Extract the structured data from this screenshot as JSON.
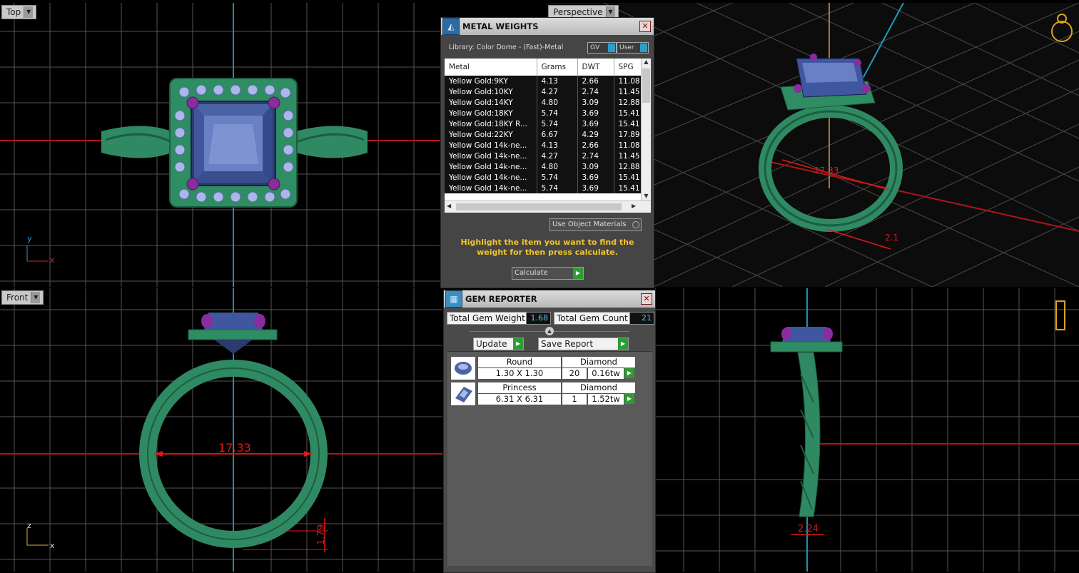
{
  "viewports": {
    "top": {
      "label": "Top"
    },
    "perspective": {
      "label": "Perspective"
    },
    "front": {
      "label": "Front"
    },
    "right": {
      "label": ""
    }
  },
  "axes": {
    "top_y": "y",
    "top_x": "x",
    "front_z": "z",
    "front_x": "x"
  },
  "dimensions": {
    "front_inner_diameter": "17.33",
    "front_band_height": "1.79",
    "right_band_width": "2.24",
    "persp_diameter": "17.33",
    "persp_small": "2.1"
  },
  "metal_weights": {
    "title": "METAL WEIGHTS",
    "library": "Library: Color Dome - (Fast)-Metal",
    "gv_label": "GV",
    "user_label": "User",
    "columns": [
      "Metal",
      "Grams",
      "DWT",
      "SPG"
    ],
    "rows": [
      [
        "Yellow Gold:9KY",
        "4.13",
        "2.66",
        "11.08"
      ],
      [
        "Yellow Gold:10KY",
        "4.27",
        "2.74",
        "11.45"
      ],
      [
        "Yellow Gold:14KY",
        "4.80",
        "3.09",
        "12.88"
      ],
      [
        "Yellow Gold:18KY",
        "5.74",
        "3.69",
        "15.41"
      ],
      [
        "Yellow Gold:18KY R...",
        "5.74",
        "3.69",
        "15.41"
      ],
      [
        "Yellow Gold:22KY",
        "6.67",
        "4.29",
        "17.89"
      ],
      [
        "Yellow Gold 14k-ne...",
        "4.13",
        "2.66",
        "11.08"
      ],
      [
        "Yellow Gold 14k-ne...",
        "4.27",
        "2.74",
        "11.45"
      ],
      [
        "Yellow Gold 14k-ne...",
        "4.80",
        "3.09",
        "12.88"
      ],
      [
        "Yellow Gold 14k-ne...",
        "5.74",
        "3.69",
        "15.41"
      ],
      [
        "Yellow Gold 14k-ne...",
        "5.74",
        "3.69",
        "15.41"
      ]
    ],
    "use_object_materials": "Use Object Materials",
    "hint": "Highlight the item you want to find the weight for then press calculate.",
    "calculate_label": "Calculate"
  },
  "gem_reporter": {
    "title": "GEM REPORTER",
    "total_weight_label": "Total Gem Weight",
    "total_weight_value": "1.68",
    "total_count_label": "Total Gem Count",
    "total_count_value": "21",
    "update_label": "Update",
    "save_report_label": "Save Report",
    "gems": [
      {
        "shape": "Round",
        "material": "Diamond",
        "size": "1.30 X 1.30",
        "count": "20",
        "weight": "0.16tw"
      },
      {
        "shape": "Princess",
        "material": "Diamond",
        "size": "6.31 X 6.31",
        "count": "1",
        "weight": "1.52tw"
      }
    ]
  },
  "colors": {
    "grid": "#5a5a5a",
    "ring": "#2f8a63",
    "stone": "#4a64a8",
    "prong": "#8a2c9e",
    "dim": "#e01818",
    "accent_green": "#2f9b35"
  }
}
